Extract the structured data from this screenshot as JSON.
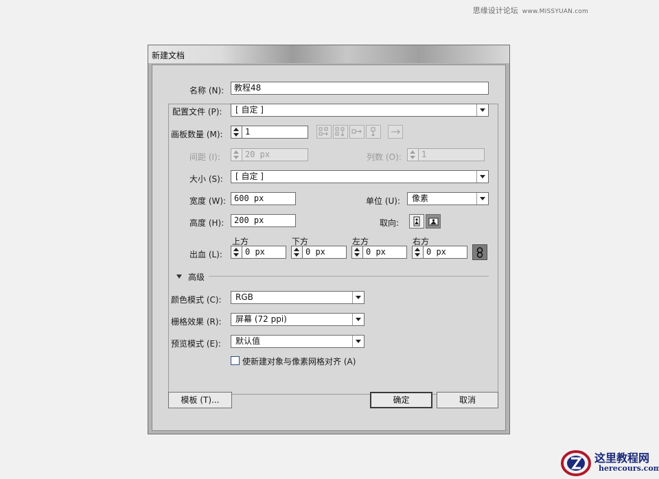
{
  "watermark": {
    "site_cn": "思缘设计论坛",
    "site_url": "www.MISSYUAN.com"
  },
  "window": {
    "title": "新建文档"
  },
  "form": {
    "name_label": "名称 (N):",
    "name_value": "教程48",
    "profile_label": "配置文件 (P):",
    "profile_value": "[ 自定 ]",
    "artboards_label": "画板数量 (M):",
    "artboards_value": "1",
    "spacing_label": "间距 (I):",
    "spacing_value": "20 px",
    "columns_label": "列数 (O):",
    "columns_value": "1",
    "size_label": "大小 (S):",
    "size_value": "[ 自定 ]",
    "width_label": "宽度 (W):",
    "width_value": "600 px",
    "units_label": "单位 (U):",
    "units_value": "像素",
    "height_label": "高度 (H):",
    "height_value": "200 px",
    "orientation_label": "取向:",
    "bleed_label": "出血 (L):",
    "bleed": {
      "top_label": "上方",
      "top_value": "0 px",
      "bottom_label": "下方",
      "bottom_value": "0 px",
      "left_label": "左方",
      "left_value": "0 px",
      "right_label": "右方",
      "right_value": "0 px"
    }
  },
  "advanced": {
    "header": "高级",
    "color_mode_label": "颜色模式 (C):",
    "color_mode_value": "RGB",
    "raster_label": "栅格效果 (R):",
    "raster_value": "屏幕 (72 ppi)",
    "preview_label": "预览模式 (E):",
    "preview_value": "默认值",
    "align_pixel_label": "使新建对象与像素网格对齐 (A)",
    "align_pixel_checked": false
  },
  "buttons": {
    "templates": "模板 (T)...",
    "ok": "确定",
    "cancel": "取消"
  },
  "brand": {
    "name_cn": "这里教程网",
    "url": "herecours.com"
  }
}
